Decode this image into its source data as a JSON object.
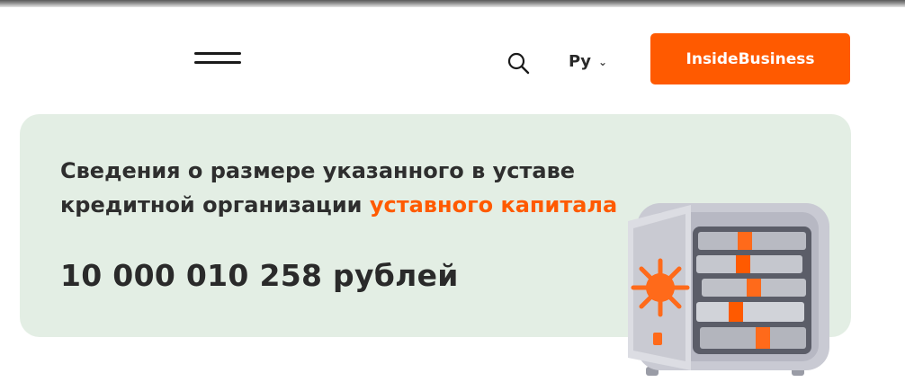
{
  "header": {
    "menu_icon": "hamburger-menu-icon",
    "search_icon": "search-icon",
    "language": "Ру",
    "language_chevron_icon": "chevron-down-icon",
    "cta_label": "InsideBusiness",
    "cta_color": "#ff5a00"
  },
  "info_card": {
    "background_color": "#e3eee4",
    "headline_part1": "Сведения о размере указанного в уставе кредитной организации ",
    "headline_accent": "уставного капитала",
    "accent_color": "#ff5a00",
    "amount": "10 000 010 258 рублей",
    "illustration_icon": "safe-with-money-icon"
  }
}
